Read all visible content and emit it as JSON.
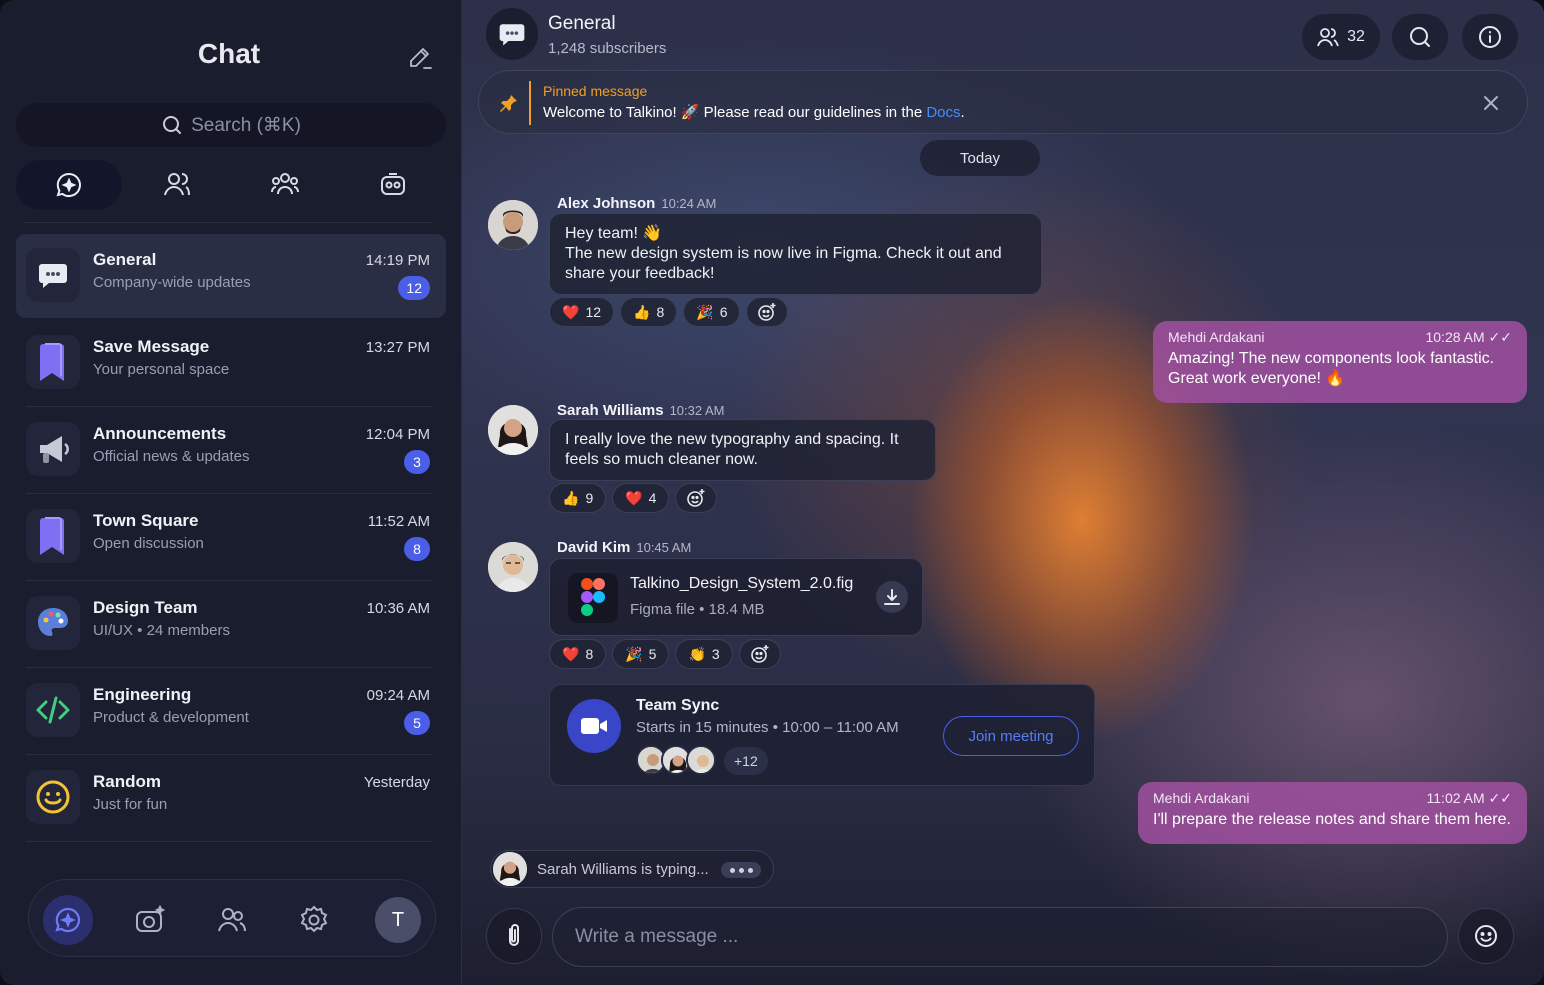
{
  "sidebar": {
    "title": "Chat",
    "search_placeholder": "Search (⌘K)",
    "tabs": [
      "chats",
      "contacts",
      "groups",
      "bots"
    ],
    "items": [
      {
        "name": "General",
        "subtitle": "Company-wide updates",
        "time": "14:19 PM",
        "badge": "12"
      },
      {
        "name": "Save Message",
        "subtitle": "Your personal space",
        "time": "13:27 PM",
        "badge": ""
      },
      {
        "name": "Announcements",
        "subtitle": "Official news & updates",
        "time": "12:04 PM",
        "badge": "3"
      },
      {
        "name": "Town Square",
        "subtitle": "Open discussion",
        "time": "11:52 AM",
        "badge": "8"
      },
      {
        "name": "Design Team",
        "subtitle": "UI/UX • 24 members",
        "time": "10:36 AM",
        "badge": ""
      },
      {
        "name": "Engineering",
        "subtitle": "Product & development",
        "time": "09:24 AM",
        "badge": "5"
      },
      {
        "name": "Random",
        "subtitle": "Just for fun",
        "time": "Yesterday",
        "badge": ""
      }
    ],
    "user_initial": "T"
  },
  "channel": {
    "name": "General",
    "subscribers": "1,248 subscribers",
    "members_count": "32"
  },
  "pinned": {
    "label": "Pinned message",
    "text": "Welcome to Talkino! 🚀 Please read our guidelines in the",
    "link": "Docs",
    "suffix": "."
  },
  "date_divider": "Today",
  "messages": {
    "m1": {
      "author": "Alex Johnson",
      "time": "10:24 AM",
      "line1": "Hey team! 👋",
      "line2": "The new design system is now live in Figma. Check it out and share your feedback!",
      "reactions": [
        {
          "emoji": "❤️",
          "count": "12"
        },
        {
          "emoji": "👍",
          "count": "8"
        },
        {
          "emoji": "🎉",
          "count": "6"
        }
      ]
    },
    "m2": {
      "author": "Mehdi Ardakani",
      "time": "10:28 AM",
      "text": "Amazing! The new components look fantastic. Great work everyone! 🔥"
    },
    "m3": {
      "author": "Sarah Williams",
      "time": "10:32 AM",
      "text": "I really love the new typography and spacing. It feels so much cleaner now.",
      "reactions": [
        {
          "emoji": "👍",
          "count": "9"
        },
        {
          "emoji": "❤️",
          "count": "4"
        }
      ]
    },
    "m4": {
      "author": "David Kim",
      "time": "10:45 AM",
      "file_name": "Talkino_Design_System_2.0.fig",
      "file_meta": "Figma file • 18.4 MB",
      "reactions": [
        {
          "emoji": "❤️",
          "count": "8"
        },
        {
          "emoji": "🎉",
          "count": "5"
        },
        {
          "emoji": "👏",
          "count": "3"
        }
      ]
    },
    "meeting": {
      "title": "Team Sync",
      "subtitle": "Starts in 15 minutes • 10:00 – 11:00 AM",
      "more": "+12",
      "join_label": "Join meeting"
    },
    "m5": {
      "author": "Mehdi Ardakani",
      "time": "11:02 AM",
      "text": "I'll prepare the release notes and share them here."
    }
  },
  "typing": "Sarah Williams is typing...",
  "composer": {
    "placeholder": "Write a message ..."
  },
  "colors": {
    "accent": "#4a5ee8",
    "pinned": "#f2a024",
    "own_bubble": "#a050a0"
  }
}
